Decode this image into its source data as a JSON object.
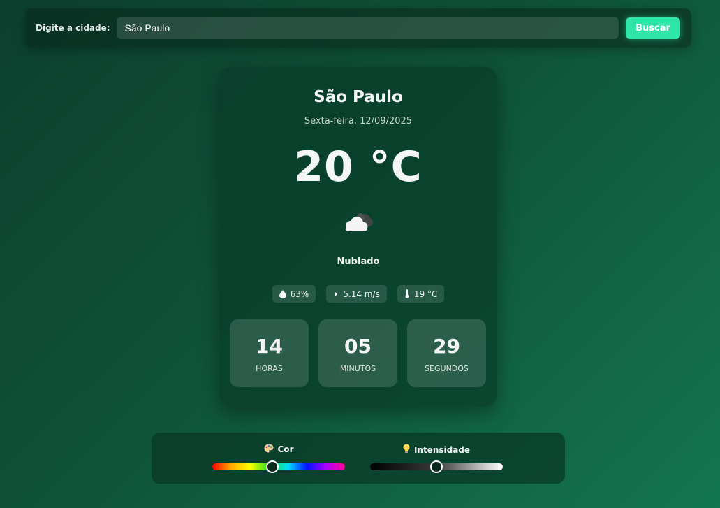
{
  "search": {
    "label": "Digite a cidade:",
    "value": "São Paulo",
    "button_label": "Buscar"
  },
  "weather": {
    "city": "São Paulo",
    "date": "Sexta-feira, 12/09/2025",
    "temperature": "20 °C",
    "icon": "cloudy-icon",
    "condition": "Nublado",
    "stats": {
      "humidity": "63%",
      "wind": "5.14 m/s",
      "feels_like": "19 °C"
    }
  },
  "clock": {
    "hours": {
      "value": "14",
      "label": "HORAS"
    },
    "minutes": {
      "value": "05",
      "label": "MINUTOS"
    },
    "seconds": {
      "value": "29",
      "label": "SEGUNDOS"
    }
  },
  "controls": {
    "color": {
      "label": "Cor",
      "icon": "palette-icon",
      "value_fraction": 0.45
    },
    "intensity": {
      "label": "Intensidade",
      "icon": "lightbulb-icon",
      "value_fraction": 0.5
    }
  },
  "colors": {
    "accent": "#2ee6a8",
    "background_start": "#0c3f2e",
    "background_end": "#137552"
  }
}
